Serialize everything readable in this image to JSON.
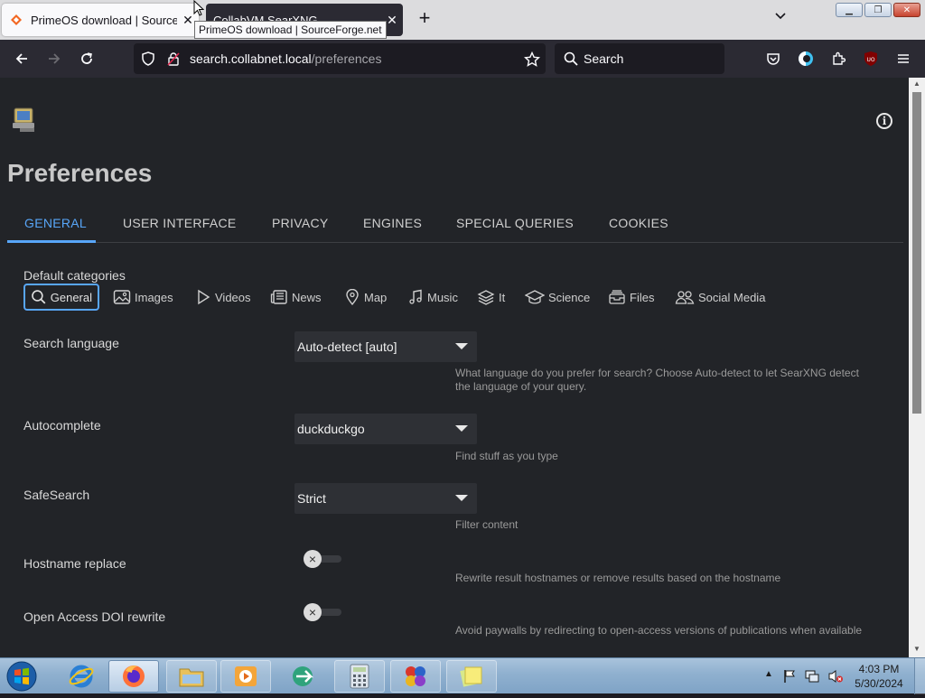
{
  "browser": {
    "tabs": [
      {
        "title": "PrimeOS download | SourceForge.net",
        "display_title": "PrimeOS download | SourceFo",
        "active": true
      },
      {
        "title": "CollabVM SearXNG",
        "display_title": "CollabVM SearXNG",
        "active": false
      }
    ],
    "tooltip": "PrimeOS download | SourceForge.net",
    "url_host": "search.collabnet.local",
    "url_path": "/preferences",
    "search_placeholder": "Search"
  },
  "page": {
    "title": "Preferences",
    "tabs": [
      "GENERAL",
      "USER INTERFACE",
      "PRIVACY",
      "ENGINES",
      "SPECIAL QUERIES",
      "COOKIES"
    ],
    "active_tab": "GENERAL",
    "default_categories": {
      "label": "Default categories",
      "items": [
        {
          "label": "General",
          "icon": "search-icon",
          "selected": true
        },
        {
          "label": "Images",
          "icon": "image-icon",
          "selected": false
        },
        {
          "label": "Videos",
          "icon": "play-icon",
          "selected": false
        },
        {
          "label": "News",
          "icon": "newspaper-icon",
          "selected": false
        },
        {
          "label": "Map",
          "icon": "map-pin-icon",
          "selected": false
        },
        {
          "label": "Music",
          "icon": "music-note-icon",
          "selected": false
        },
        {
          "label": "It",
          "icon": "layers-icon",
          "selected": false
        },
        {
          "label": "Science",
          "icon": "school-icon",
          "selected": false
        },
        {
          "label": "Files",
          "icon": "file-tray-icon",
          "selected": false
        },
        {
          "label": "Social Media",
          "icon": "people-icon",
          "selected": false
        }
      ]
    },
    "settings": {
      "search_language": {
        "label": "Search language",
        "value": "Auto-detect [auto]",
        "help": "What language do you prefer for search? Choose Auto-detect to let SearXNG detect the language of your query."
      },
      "autocomplete": {
        "label": "Autocomplete",
        "value": "duckduckgo",
        "help": "Find stuff as you type"
      },
      "safesearch": {
        "label": "SafeSearch",
        "value": "Strict",
        "help": "Filter content"
      },
      "hostname_replace": {
        "label": "Hostname replace",
        "enabled": false,
        "help": "Rewrite result hostnames or remove results based on the hostname"
      },
      "doi_rewrite": {
        "label": "Open Access DOI rewrite",
        "enabled": false,
        "help": "Avoid paywalls by redirecting to open-access versions of publications when available"
      }
    }
  },
  "taskbar": {
    "time": "4:03 PM",
    "date": "5/30/2024"
  },
  "colors": {
    "accent": "#58a6f8",
    "page_bg": "#222428",
    "browser_chrome": "#2b2a33"
  }
}
